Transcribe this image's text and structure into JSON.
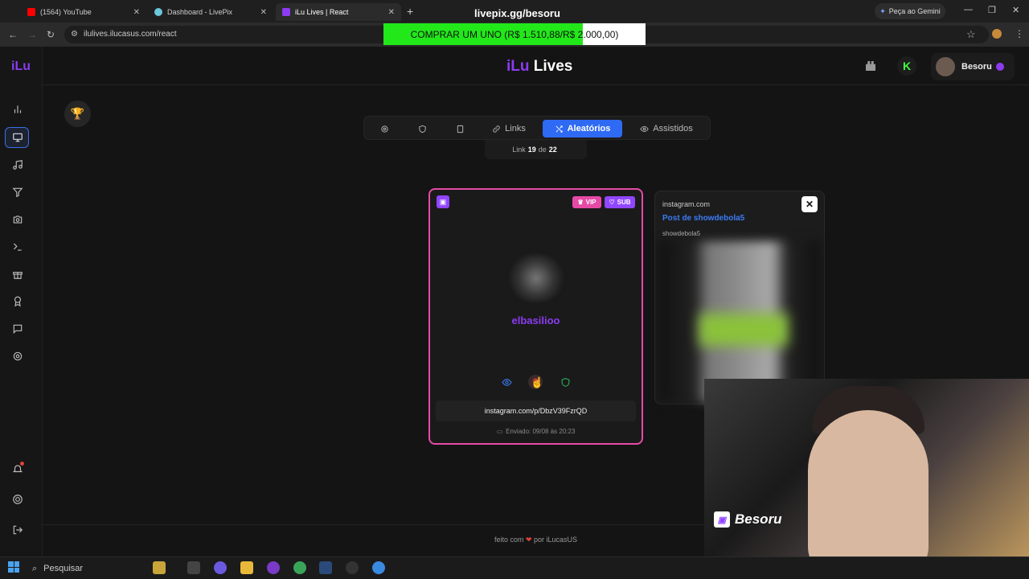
{
  "browser": {
    "tabs": [
      {
        "label": "(1564) YouTube",
        "color": "#ff0000"
      },
      {
        "label": "Dashboard - LivePix",
        "color": "#6bc7d9"
      },
      {
        "label": "iLu Lives | React",
        "color": "#8b3cf0"
      }
    ],
    "window_title": "livepix.gg/besoru",
    "gemini_label": "Peça ao Gemini",
    "url": "ilulives.ilucasus.com/react",
    "promo_banner": "COMPRAR UM UNO (R$ 1.510,88/R$ 2.000,00)",
    "promo_progress": 0.755
  },
  "app": {
    "logo_small": "iLu",
    "logo_prefix": "iLu",
    "logo_suffix": " Lives",
    "user": {
      "name": "Besoru",
      "verified": true
    },
    "kick_label": "K",
    "sidebar_icons": [
      "chart-icon",
      "monitor-icon",
      "music-icon",
      "filter-icon",
      "camera-icon",
      "terminal-icon",
      "gift-icon",
      "award-icon",
      "chat-icon",
      "settings-icon",
      "bell-icon",
      "lifebuoy-icon",
      "logout-icon"
    ]
  },
  "tabs": {
    "links": "Links",
    "random": "Aleatórios",
    "watched": "Assistidos"
  },
  "counter": {
    "prefix": "Link",
    "current": "19",
    "sep": "de",
    "total": "22"
  },
  "card": {
    "vip": "VIP",
    "sub": "SUB",
    "username": "elbasilioo",
    "link": "instagram.com/p/DbzV39FzrQD",
    "date": "Enviado: 09/08 às 20:23"
  },
  "preview": {
    "domain": "instagram.com",
    "title": "Post de showdebola5",
    "user": "showdebola5"
  },
  "footer": {
    "before": "feito com",
    "after": "por iLucasUS"
  },
  "webcam": {
    "label": "Besoru"
  },
  "taskbar": {
    "search": "Pesquisar"
  },
  "colors": {
    "accent_purple": "#8b3cf0",
    "accent_blue": "#2f6af5",
    "card_border": "#e64aa6",
    "promo_green": "#22e81a"
  }
}
